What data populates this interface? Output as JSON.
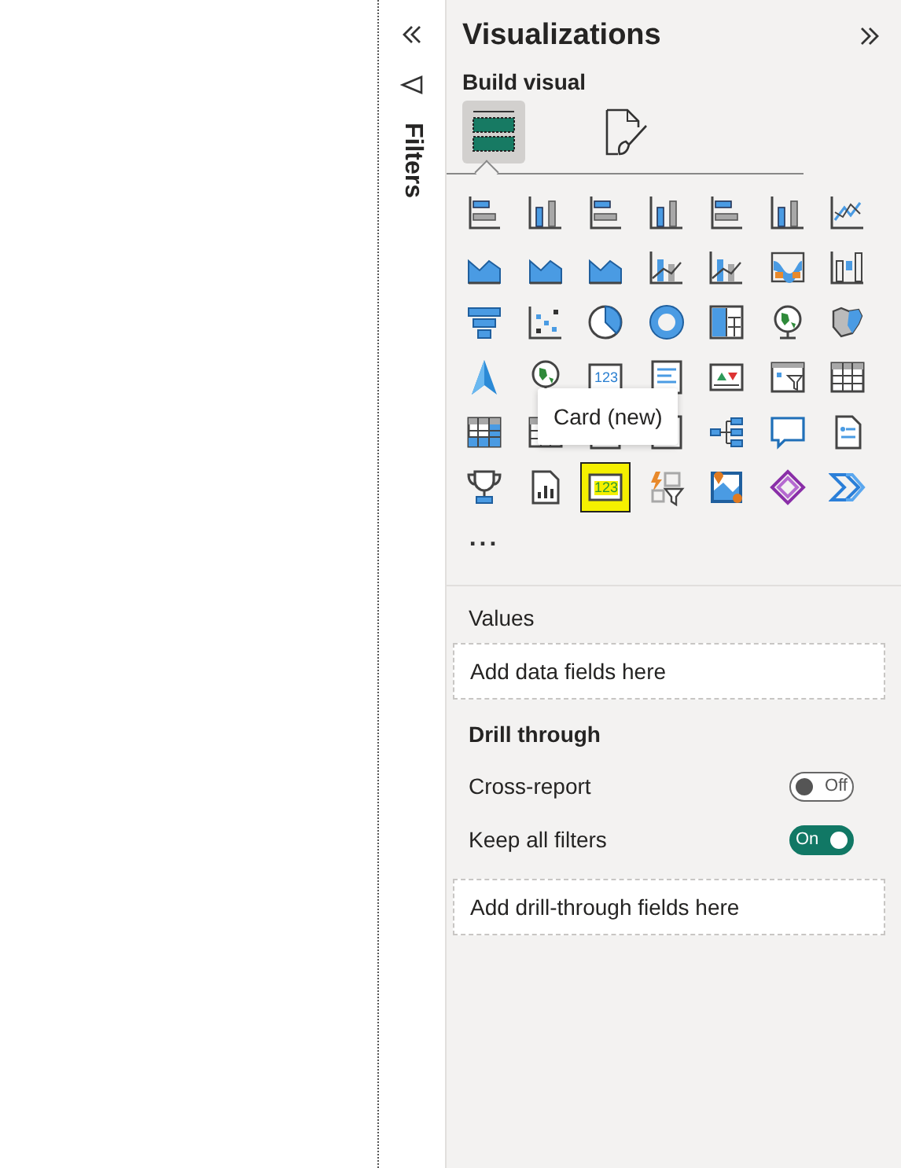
{
  "filters_pane": {
    "label": "Filters"
  },
  "visualizations": {
    "title": "Visualizations",
    "build_label": "Build visual",
    "build_tabs": [
      {
        "kind": "fields",
        "selected": true
      },
      {
        "kind": "format",
        "selected": false
      }
    ],
    "visuals": [
      {
        "kind": "hbar",
        "selected": false
      },
      {
        "kind": "column",
        "selected": false
      },
      {
        "kind": "hbar",
        "selected": false
      },
      {
        "kind": "column",
        "selected": false
      },
      {
        "kind": "hbar",
        "selected": false
      },
      {
        "kind": "column",
        "selected": false
      },
      {
        "kind": "line",
        "selected": false
      },
      {
        "kind": "area",
        "selected": false
      },
      {
        "kind": "area",
        "selected": false
      },
      {
        "kind": "area",
        "selected": false
      },
      {
        "kind": "combo",
        "selected": false
      },
      {
        "kind": "combo",
        "selected": false
      },
      {
        "kind": "ribbon",
        "selected": false
      },
      {
        "kind": "waterfall",
        "selected": false
      },
      {
        "kind": "funnel",
        "selected": false
      },
      {
        "kind": "scatter",
        "selected": false
      },
      {
        "kind": "pie",
        "selected": false
      },
      {
        "kind": "donut",
        "selected": false
      },
      {
        "kind": "treemap",
        "selected": false
      },
      {
        "kind": "globe",
        "selected": false
      },
      {
        "kind": "map",
        "selected": false
      },
      {
        "kind": "arrow",
        "selected": false
      },
      {
        "kind": "globe",
        "selected": false
      },
      {
        "kind": "card",
        "text": "123",
        "selected": false
      },
      {
        "kind": "doc",
        "selected": false
      },
      {
        "kind": "kpi",
        "selected": false
      },
      {
        "kind": "slicer",
        "selected": false
      },
      {
        "kind": "table",
        "selected": false
      },
      {
        "kind": "matrix",
        "selected": false
      },
      {
        "kind": "table",
        "selected": false
      },
      {
        "kind": "doc",
        "selected": false
      },
      {
        "kind": "doc",
        "selected": false
      },
      {
        "kind": "tree",
        "selected": false
      },
      {
        "kind": "chat",
        "selected": false
      },
      {
        "kind": "page",
        "selected": false
      },
      {
        "kind": "trophy",
        "selected": false
      },
      {
        "kind": "report",
        "selected": false
      },
      {
        "kind": "card",
        "text": "123",
        "selected": true
      },
      {
        "kind": "filtercard",
        "selected": false
      },
      {
        "kind": "azuremap",
        "selected": false
      },
      {
        "kind": "apps",
        "selected": false
      },
      {
        "kind": "automate",
        "selected": false
      }
    ],
    "more": "...",
    "tooltip": "Card (new)",
    "values_label": "Values",
    "values_placeholder": "Add data fields here",
    "drill_label": "Drill through",
    "toggles": [
      {
        "label": "Cross-report",
        "on": false,
        "state": "Off"
      },
      {
        "label": "Keep all filters",
        "on": true,
        "state": "On"
      }
    ],
    "drill_placeholder": "Add drill-through fields here"
  }
}
